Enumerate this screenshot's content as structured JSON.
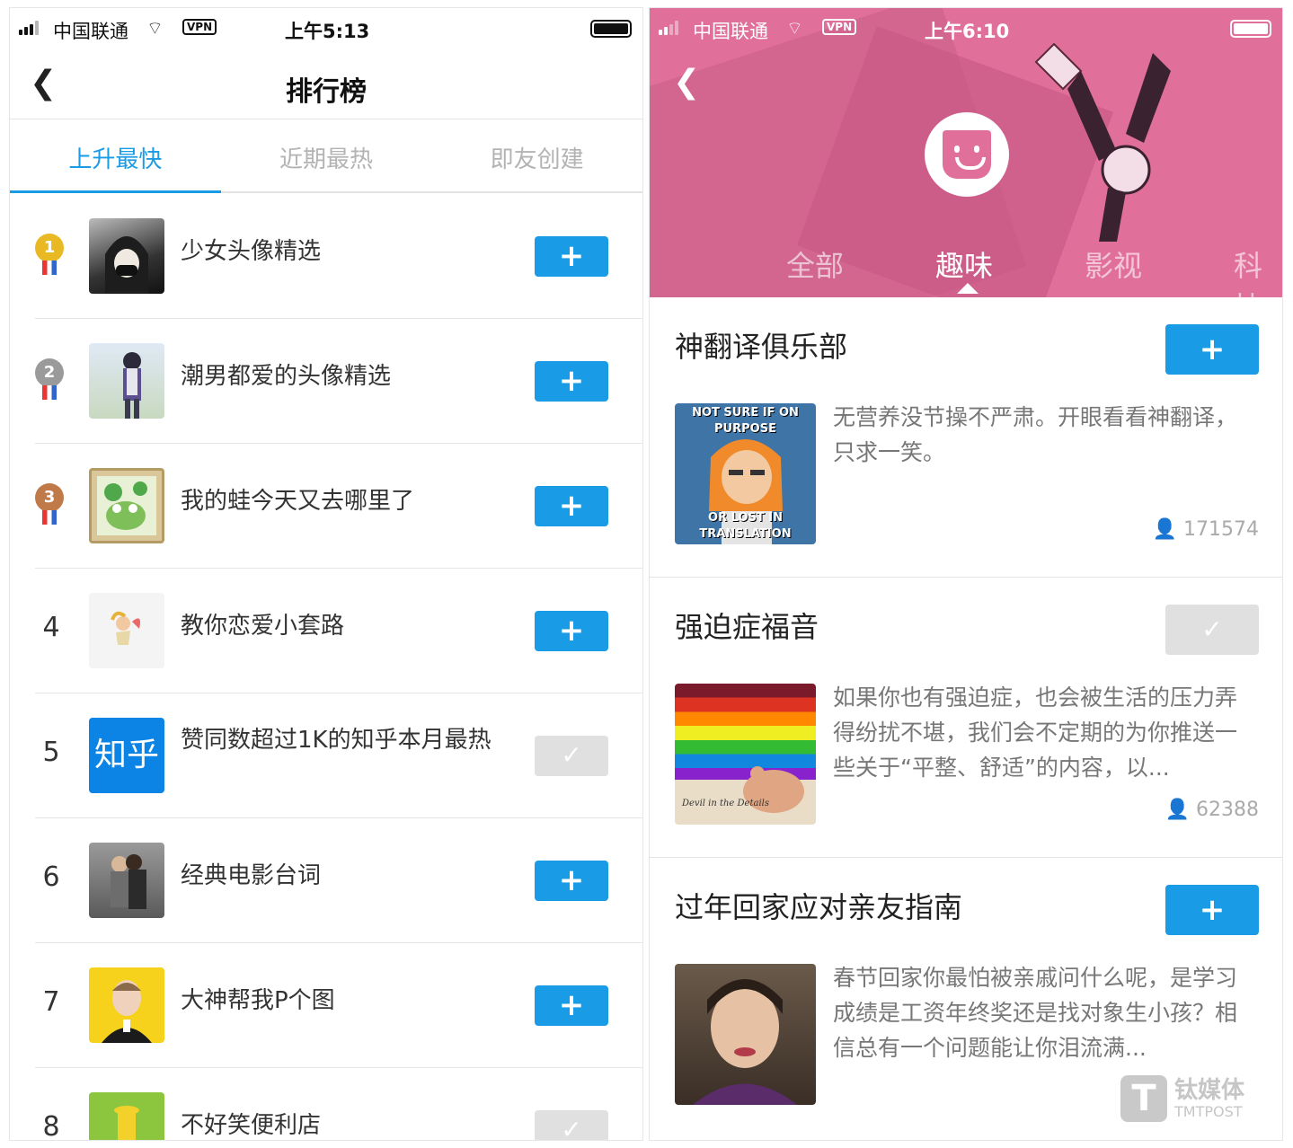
{
  "left": {
    "status": {
      "carrier": "中国联通",
      "vpn": "VPN",
      "time": "上午5:13"
    },
    "nav": {
      "back_icon": "chevron-left-icon",
      "title": "排行榜"
    },
    "tabs": [
      {
        "label": "上升最快",
        "active": true
      },
      {
        "label": "近期最热",
        "active": false
      },
      {
        "label": "即友创建",
        "active": false
      }
    ],
    "rows": [
      {
        "rank": "1",
        "medal": "gold",
        "name": "少女头像精选",
        "subscribed": false
      },
      {
        "rank": "2",
        "medal": "silver",
        "name": "潮男都爱的头像精选",
        "subscribed": false
      },
      {
        "rank": "3",
        "medal": "bronze",
        "name": "我的蛙今天又去哪里了",
        "subscribed": false
      },
      {
        "rank": "4",
        "name": "教你恋爱小套路",
        "subscribed": false
      },
      {
        "rank": "5",
        "name": "赞同数超过1K的知乎本月最热",
        "subscribed": true,
        "avatar_text": "知乎"
      },
      {
        "rank": "6",
        "name": "经典电影台词",
        "subscribed": false
      },
      {
        "rank": "7",
        "name": "大神帮我P个图",
        "subscribed": false
      },
      {
        "rank": "8",
        "name": "不好笑便利店",
        "subscribed": true
      }
    ],
    "add_label": "+",
    "done_label": "✓"
  },
  "right": {
    "status": {
      "carrier": "中国联通",
      "vpn": "VPN",
      "time": "上午6:10"
    },
    "categories": [
      {
        "label": "全部",
        "active": false
      },
      {
        "label": "趣味",
        "active": true
      },
      {
        "label": "影视",
        "active": false
      },
      {
        "label": "科技",
        "active": false
      }
    ],
    "clubs": [
      {
        "title": "神翻译俱乐部",
        "subscribed": false,
        "image_caption_top": "NOT SURE IF ON PURPOSE",
        "image_caption_bottom": "OR LOST IN TRANSLATION",
        "desc": "无营养没节操不严肃。开眼看看神翻译，只求一笑。",
        "count": "171574"
      },
      {
        "title": "强迫症福音",
        "subscribed": true,
        "image_caption": "Devil in the Details",
        "desc": "如果你也有强迫症，也会被生活的压力弄得纷扰不堪，我们会不定期的为你推送一些关于“平整、舒适”的内容，以...",
        "count": "62388"
      },
      {
        "title": "过年回家应对亲友指南",
        "subscribed": false,
        "desc": "春节回家你最怕被亲戚问什么呢，是学习成绩是工资年终奖还是找对象生小孩？相信总有一个问题能让你泪流满...",
        "count": ""
      }
    ]
  },
  "watermark": {
    "text": "钛媒体",
    "sub": "TMTPOST"
  },
  "colors": {
    "accent": "#1a9be6",
    "hero": "#e0709a",
    "subscribed": "#e0e0e0"
  }
}
